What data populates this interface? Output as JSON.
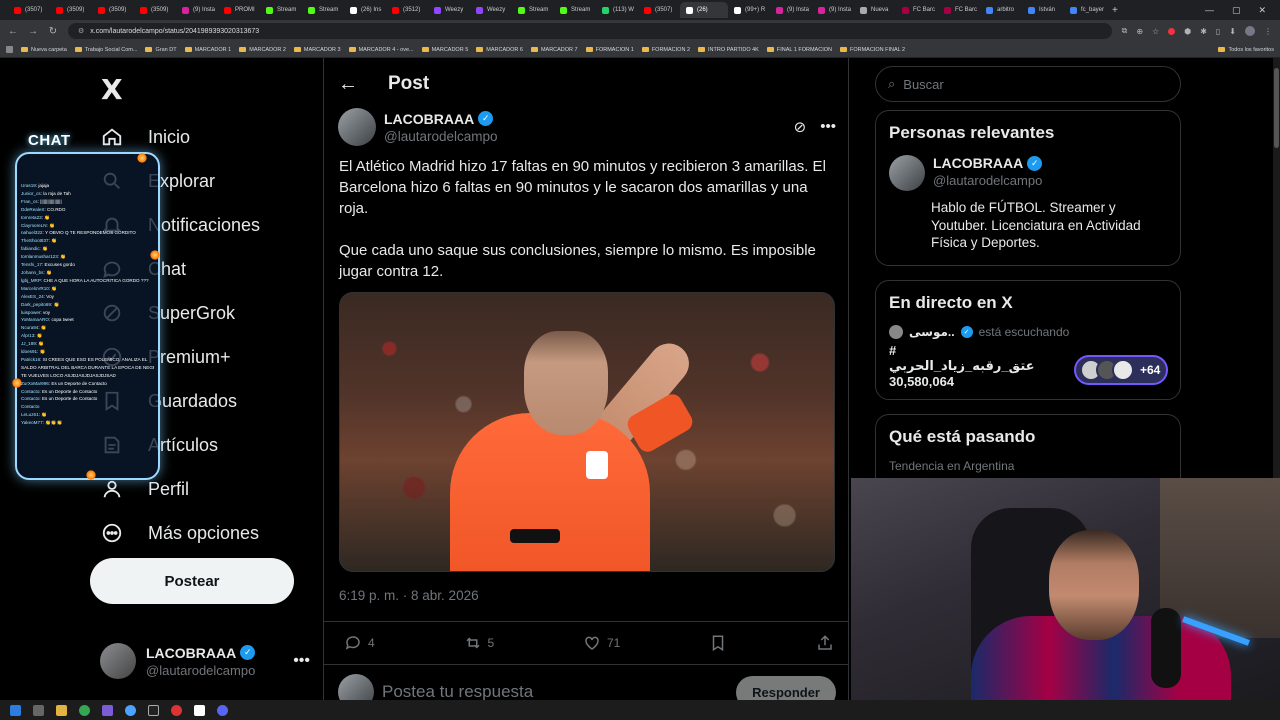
{
  "browser": {
    "tabs": [
      {
        "label": "(3507)",
        "color": "#ff0000"
      },
      {
        "label": "(3509)",
        "color": "#ff0000"
      },
      {
        "label": "(3509)",
        "color": "#ff0000"
      },
      {
        "label": "(3509)",
        "color": "#ff0000"
      },
      {
        "label": "(9) Insta",
        "color": "#d6249f"
      },
      {
        "label": "PROMI",
        "color": "#ff0000"
      },
      {
        "label": "Stream",
        "color": "#53fc18"
      },
      {
        "label": "Stream",
        "color": "#53fc18"
      },
      {
        "label": "(26) Ins",
        "color": "#ffffff"
      },
      {
        "label": "(3512)",
        "color": "#ff0000"
      },
      {
        "label": "Weezy",
        "color": "#9146ff"
      },
      {
        "label": "Weezy",
        "color": "#9146ff"
      },
      {
        "label": "Stream",
        "color": "#53fc18"
      },
      {
        "label": "Stream",
        "color": "#53fc18"
      },
      {
        "label": "(113) W",
        "color": "#25d366"
      },
      {
        "label": "(3507)",
        "color": "#ff0000"
      },
      {
        "label": "(26)",
        "color": "#ffffff",
        "active": true
      },
      {
        "label": "(99+) R",
        "color": "#ffffff"
      },
      {
        "label": "(9) Insta",
        "color": "#d6249f"
      },
      {
        "label": "(9) Insta",
        "color": "#d6249f"
      },
      {
        "label": "Nueva",
        "color": "#aaaaaa"
      },
      {
        "label": "FC Barc",
        "color": "#a50044"
      },
      {
        "label": "FC Barc",
        "color": "#a50044"
      },
      {
        "label": "arbitro",
        "color": "#4285f4"
      },
      {
        "label": "István",
        "color": "#4285f4"
      },
      {
        "label": "fc_bayer",
        "color": "#4285f4"
      }
    ],
    "new_tab": "+",
    "url": "x.com/lautarodelcampo/status/2041989393020313673",
    "bookmarks": [
      "Nueva carpeta",
      "Trabajo Social Com...",
      "Gran DT",
      "MARCADOR 1",
      "MARCADOR 2",
      "MARCADOR 3",
      "MARCADOR 4 - ove...",
      "MARCADOR 5",
      "MARCADOR 6",
      "MARCADOR 7",
      "FORMACION 1",
      "FORMACION 2",
      "INTRO PARTIDO 4K",
      "FINAL 1 FORMACION",
      "FORMACION FINAL 2"
    ],
    "all_bookmarks": "Todos los favoritos"
  },
  "sidebar": {
    "logo": "X",
    "items": [
      {
        "label": "Inicio",
        "icon": "home-icon"
      },
      {
        "label": "Explorar",
        "icon": "search-icon"
      },
      {
        "label": "Notificaciones",
        "icon": "bell-icon"
      },
      {
        "label": "Chat",
        "icon": "chat-icon"
      },
      {
        "label": "SuperGrok",
        "icon": "grok-icon"
      },
      {
        "label": "Premium+",
        "icon": "premium-icon"
      },
      {
        "label": "Guardados",
        "icon": "bookmark-icon"
      },
      {
        "label": "Artículos",
        "icon": "articles-icon"
      },
      {
        "label": "Perfil",
        "icon": "profile-icon"
      },
      {
        "label": "Más opciones",
        "icon": "more-icon"
      }
    ],
    "post_button": "Postear",
    "account": {
      "name": "LACOBRAAA",
      "handle": "@lautarodelcampo"
    }
  },
  "chat_overlay": {
    "title": "CHAT",
    "lines": [
      {
        "user": "Uras19",
        "msg": ": jajaja"
      },
      {
        "user": "Junior_cs",
        "msg": ": la roja de Tah"
      },
      {
        "user": "Fran_cs",
        "msg": ": ||||||||||||||||||"
      },
      {
        "user": "DdeRealeX",
        "msg": ": CO.RDO"
      },
      {
        "user": "tomreta23",
        "msg": ": 👏"
      },
      {
        "user": "ClaymoreLN",
        "msg": ": 👏"
      },
      {
        "user": "nahuel322",
        "msg": ": Y OBVIO Q TE RESPONDEMOS GORDITO"
      },
      {
        "user": "TheShoot837",
        "msg": ": 👏"
      },
      {
        "user": "fabiandic",
        "msg": ": 👏"
      },
      {
        "user": "tomlanmushar123",
        "msg": ": 👏"
      },
      {
        "user": "Tenshi_17",
        "msg": ": Excuses gordo"
      },
      {
        "user": "Johann_bs",
        "msg": ": 👏"
      },
      {
        "user": "lgbj_MRP",
        "msg": ": CHE A QUE HORA LA AUTOCRITICA GORDO ???"
      },
      {
        "user": "MarceloVR10",
        "msg": ": 👏"
      },
      {
        "user": "AlexES_24",
        "msg": ": Voy"
      },
      {
        "user": "Dark_pepito69",
        "msg": ": 👏"
      },
      {
        "user": "luispower",
        "msg": ": voy"
      },
      {
        "user": "YoMamaARO",
        "msg": ": copa tweet"
      },
      {
        "user": "Ncura94",
        "msg": ": 👏"
      },
      {
        "user": "Alpr13",
        "msg": ": 👏"
      },
      {
        "user": "JJ_189",
        "msg": ": 👏"
      },
      {
        "user": "ldoes91",
        "msg": ": 👏"
      },
      {
        "user": "Patrick16",
        "msg": ": SI CREES QUE ESO ES POLEMICO, ANALIZA EL"
      },
      {
        "user": "",
        "msg": "SALDO ARBITRAL DEL BARCA DURANTE LA EPOCA DE NEGREIRA"
      },
      {
        "user": "",
        "msg": "TE VUELVES LOCO ASJDJASJDJASJDJSAD"
      },
      {
        "user": "ZurXxMar996",
        "msg": ": Es un Deporte de Contacto"
      },
      {
        "user": "Contacto",
        "msg": ": Es un Deporte de Contacto"
      },
      {
        "user": "Contacto",
        "msg": ": Es un Deporte de Contacto"
      },
      {
        "user": "Contacto",
        "msg": ""
      },
      {
        "user": "LeLuz61",
        "msg": ": 👏"
      },
      {
        "user": "YakeoM77",
        "msg": ": 👏👏👏"
      }
    ]
  },
  "post": {
    "header_title": "Post",
    "author_name": "LACOBRAAA",
    "author_handle": "@lautarodelcampo",
    "text_p1": "El Atlético Madrid hizo 17 faltas en 90 minutos y recibieron 3 amarillas. El Barcelona hizo 6 faltas en 90 minutos y le sacaron dos amarillas y una roja.",
    "text_p2": "Que cada uno saque sus conclusiones, siempre lo mismo. Es imposible jugar contra 12.",
    "timestamp": "6:19 p. m. · 8 abr. 2026",
    "replies": "4",
    "reposts": "5",
    "likes": "71",
    "reply_placeholder": "Postea tu respuesta",
    "reply_button": "Responder"
  },
  "right": {
    "search_placeholder": "Buscar",
    "relevant_title": "Personas relevantes",
    "relevant_user": {
      "name": "LACOBRAAA",
      "handle": "@lautarodelcampo",
      "bio": "Hablo de FÚTBOL. Streamer y Youtuber. Licenciatura en Actividad Física y Deportes."
    },
    "live_title": "En directo en X",
    "live_host": "موسی..",
    "live_status": "está escuchando",
    "live_space_title": "# عتق_رقبه_زياد_الحربي",
    "live_count": "30,580,064",
    "live_extra": "+64",
    "trending_title": "Qué está pasando",
    "trending_label": "Tendencia en Argentina"
  }
}
